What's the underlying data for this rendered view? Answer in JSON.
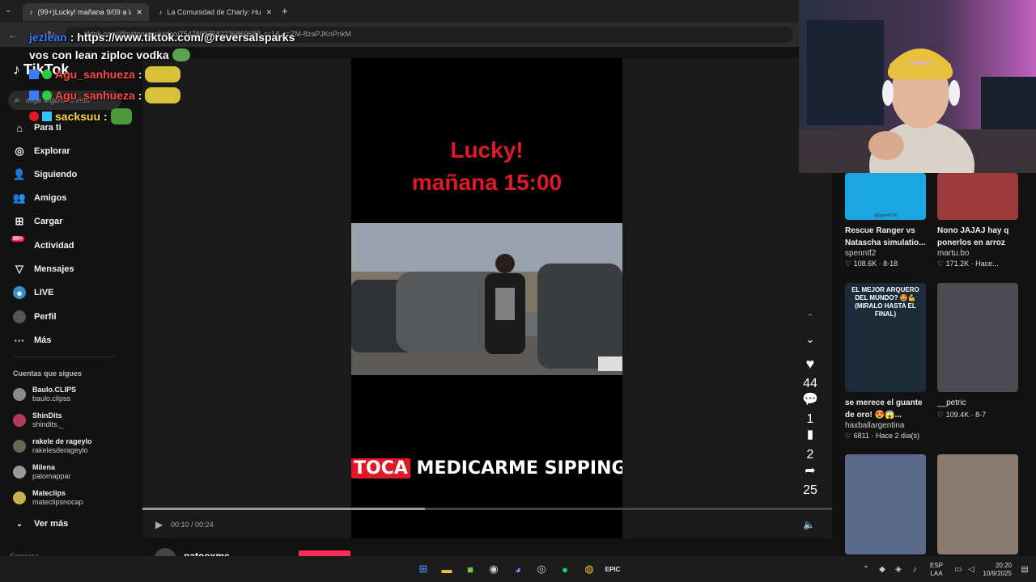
{
  "browser": {
    "tabs": [
      {
        "label": "(99+)Lucky! mañana 9/09 a las",
        "active": true
      },
      {
        "label": "La Comunidad de Charly: Hum",
        "active": false
      }
    ],
    "url": "tiktok.com/@patooxmc/video/7547808758223686968?_r=1&_t=ZM-8zaPJKnPnkM"
  },
  "sidebar": {
    "logo": "TikTok",
    "search_placeholder": "elige argentino indo",
    "nav": [
      {
        "label": "Para ti",
        "icon": "home-icon"
      },
      {
        "label": "Explorar",
        "icon": "compass-icon"
      },
      {
        "label": "Siguiendo",
        "icon": "following-icon"
      },
      {
        "label": "Amigos",
        "icon": "friends-icon"
      },
      {
        "label": "Cargar",
        "icon": "upload-icon"
      },
      {
        "label": "Actividad",
        "icon": "activity-icon",
        "badge": "99+"
      },
      {
        "label": "Mensajes",
        "icon": "messages-icon"
      },
      {
        "label": "LIVE",
        "icon": "live-icon"
      },
      {
        "label": "Perfil",
        "icon": "profile-icon"
      },
      {
        "label": "Más",
        "icon": "more-icon"
      }
    ],
    "following_heading": "Cuentas que sigues",
    "following": [
      {
        "name": "Baulo.CLIPS",
        "handle": "baulo.clipss"
      },
      {
        "name": "ShinDits",
        "handle": "shindits._"
      },
      {
        "name": "rakele de rageylo",
        "handle": "rakelesderageylo"
      },
      {
        "name": "Milena",
        "handle": "palomappar"
      },
      {
        "name": "Mateclips",
        "handle": "mateclipsnocap"
      }
    ],
    "see_more": "Ver más",
    "footer": "Empresa"
  },
  "video": {
    "title_line1": "Lucky!",
    "title_line2": "mañana 15:00",
    "caption_red": "TOCA",
    "caption_rest": " MEDICARME SIPPING CODE",
    "time_current": "00:10",
    "time_total": "00:24",
    "progress": 0.41,
    "author": "patooxmc",
    "likes": "44",
    "comments": "1",
    "saves": "2",
    "shares": "25"
  },
  "recommendations": [
    {
      "title": "Rescue Ranger vs Natascha simulatio...",
      "user": "spenntf2",
      "likes": "108.6K",
      "date": "8-18",
      "thumb_color": "#1aa6e0",
      "thumb_text": "@SpennTF2"
    },
    {
      "title": "Nono JAJAJ hay q ponerlos en arroz",
      "user": "martu.bo",
      "likes": "171.2K",
      "date": "Hace...",
      "thumb_color": "#9a3a3a",
      "thumb_text": ""
    },
    {
      "title": "se merece el guante de oro! 😍😱...",
      "user": "haxballargentina",
      "likes": "6811",
      "date": "Hace 2 día(s)",
      "thumb_color": "#1b2b3a",
      "thumb_text": "EL MEJOR ARQUERO DEL MUNDO? 🤩💪 (MIRALO HASTA EL FINAL)"
    },
    {
      "title": "__petric",
      "user": "",
      "likes": "109.4K",
      "date": "8-7",
      "thumb_color": "#4a4a50",
      "thumb_text": ""
    },
    {
      "title": "",
      "user": "",
      "likes": "",
      "date": "",
      "thumb_color": "#5a6a8a",
      "thumb_text": ""
    },
    {
      "title": "",
      "user": "",
      "likes": "",
      "date": "",
      "thumb_color": "#8a7a70",
      "thumb_text": ""
    }
  ],
  "chat": [
    {
      "user": "jezlean",
      "text": ": https://www.tiktok.com/@reversalsparks",
      "color": "#3a7bff"
    },
    {
      "user": "",
      "text": "vos con lean ziploc vodka",
      "color": "#ffffff"
    },
    {
      "user": "Agu_sanhueza",
      "text": ":",
      "color": "#ff4a4a"
    },
    {
      "user": "Agu_sanhueza",
      "text": ":",
      "color": "#ff4a4a"
    },
    {
      "user": "sacksuu",
      "text": ":",
      "color": "#ffd54a"
    }
  ],
  "taskbar": {
    "lang": "ESP",
    "lang2": "LAA",
    "time": "20:20",
    "date": "10/9/2025"
  }
}
